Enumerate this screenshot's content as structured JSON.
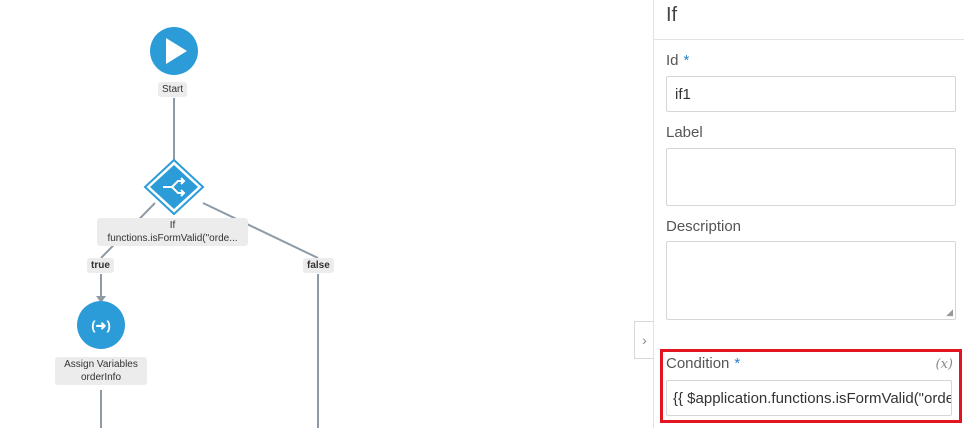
{
  "flow": {
    "start_label": "Start",
    "if_label_line1": "If",
    "if_label_line2": "functions.isFormValid(\"orde...",
    "true_label": "true",
    "false_label": "false",
    "assign_label_line1": "Assign Variables",
    "assign_label_line2": "orderInfo"
  },
  "panel": {
    "title": "If",
    "collapse_glyph": "›",
    "id_label": "Id",
    "required_mark": "*",
    "id_value": "if1",
    "label_label": "Label",
    "label_value": "",
    "description_label": "Description",
    "description_value": "",
    "condition_label": "Condition",
    "condition_expr_icon": "(x)",
    "condition_value": "{{ $application.functions.isFormValid(\"orderInfo\") }}"
  },
  "colors": {
    "node_blue": "#2c9cd9",
    "connector_gray": "#8e9aa6",
    "highlight_red": "#e0151f",
    "required_blue": "#2a7fc8"
  },
  "icons": {
    "start": "play-icon",
    "if": "branch-split-icon",
    "assign": "assign-arrow-icon",
    "collapse": "chevron-right-icon",
    "expression": "expression-x-icon"
  }
}
